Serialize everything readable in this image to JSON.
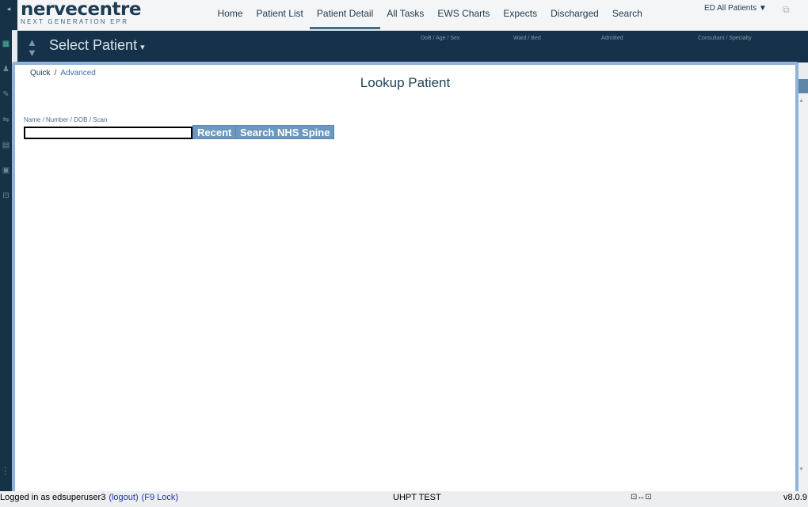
{
  "app": {
    "logo_main": "nervecentre",
    "logo_sub": "NEXT GENERATION EPR"
  },
  "nav": {
    "items": [
      "Home",
      "Patient List",
      "Patient Detail",
      "All Tasks",
      "EWS Charts",
      "Expects",
      "Discharged",
      "Search"
    ],
    "active_index": 2,
    "ward_select": "ED All Patients ▼"
  },
  "banner": {
    "title": "Select Patient",
    "caret": "▾",
    "up_arrow": "▲",
    "down_arrow": "▼",
    "col_dob": "DoB / Age / Sex",
    "col_ward": "Ward / Bed",
    "col_admitted": "Admitted",
    "col_consultant": "Consultant / Specialty"
  },
  "dialog": {
    "mode_quick": "Quick",
    "mode_separator": "/",
    "mode_advanced": "Advanced",
    "title": "Lookup Patient",
    "field_label": "Name / Number / DOB / Scan",
    "field_value": "",
    "field_placeholder": "",
    "recent_button": "Recent",
    "spine_button": "Search NHS Spine"
  },
  "statusbar": {
    "logged_in": "Logged in as edsuperuser3",
    "logout_link": "(logout)",
    "lock_link": "(F9 Lock)",
    "environment": "UHPT TEST",
    "connection_icon": "⊡↔⊡",
    "version": "v8.0.9"
  },
  "colors": {
    "banner": "#16324a",
    "dialog_border": "#8fb3d9",
    "button": "#6c97c0"
  }
}
